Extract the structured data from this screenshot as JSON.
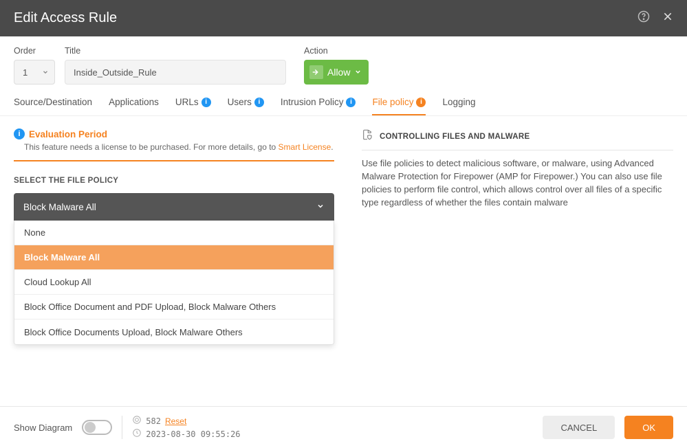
{
  "header": {
    "title": "Edit Access Rule"
  },
  "form": {
    "order_label": "Order",
    "order_value": "1",
    "title_label": "Title",
    "title_value": "Inside_Outside_Rule",
    "action_label": "Action",
    "action_value": "Allow"
  },
  "tabs": [
    {
      "label": "Source/Destination",
      "badge": null
    },
    {
      "label": "Applications",
      "badge": null
    },
    {
      "label": "URLs",
      "badge": "info"
    },
    {
      "label": "Users",
      "badge": "info"
    },
    {
      "label": "Intrusion Policy",
      "badge": "info"
    },
    {
      "label": "File policy",
      "badge": "orange",
      "active": true
    },
    {
      "label": "Logging",
      "badge": null
    }
  ],
  "evaluation": {
    "title": "Evaluation Period",
    "text": "This feature needs a license to be purchased. For more details, go to ",
    "link": "Smart License"
  },
  "policy": {
    "section_label": "SELECT THE FILE POLICY",
    "selected": "Block Malware All",
    "options": [
      "None",
      "Block Malware All",
      "Cloud Lookup All",
      "Block Office Document and PDF Upload, Block Malware Others",
      "Block Office Documents Upload, Block Malware Others"
    ]
  },
  "info": {
    "heading": "CONTROLLING FILES AND MALWARE",
    "body": "Use file policies to detect malicious software, or malware, using Advanced Malware Protection for Firepower (AMP for Firepower.) You can also use file policies to perform file control, which allows control over all files of a specific type regardless of whether the files contain malware"
  },
  "footer": {
    "diagram_label": "Show Diagram",
    "count": "582",
    "reset": "Reset",
    "timestamp": "2023-08-30 09:55:26",
    "cancel": "CANCEL",
    "ok": "OK"
  }
}
